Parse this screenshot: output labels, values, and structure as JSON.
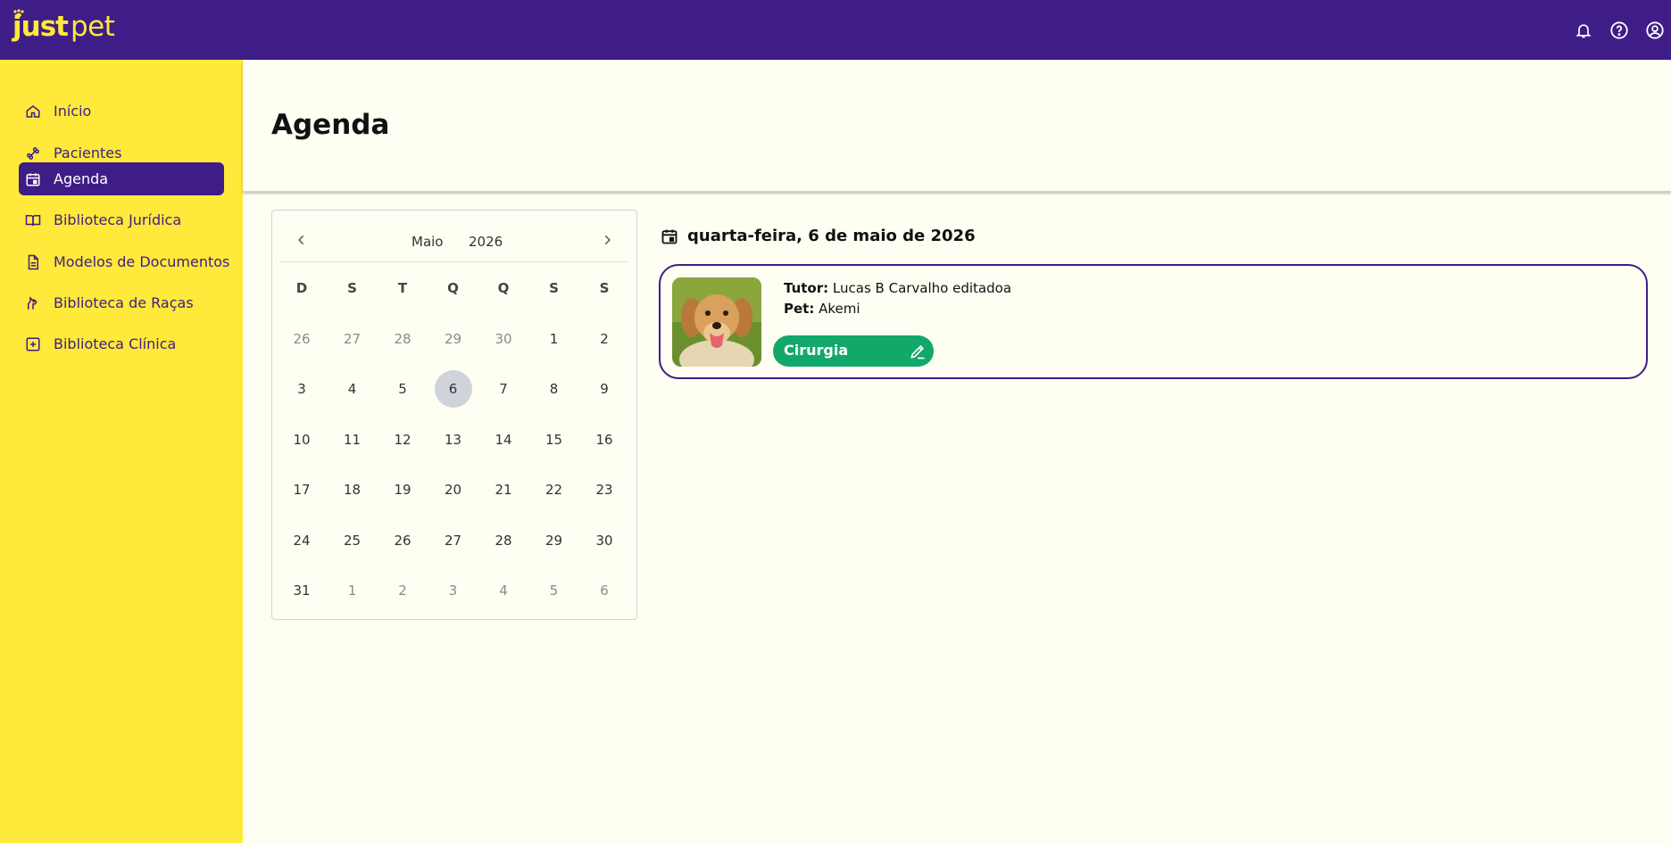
{
  "brand": {
    "part1": "just",
    "part2": "pet",
    "color_bg": "#3f1d87",
    "color_accent": "#ffe93a"
  },
  "topbar_icons": [
    "bell-icon",
    "help-icon",
    "account-icon"
  ],
  "sidebar": {
    "items": [
      {
        "label": "Início",
        "icon": "home-icon",
        "active": false
      },
      {
        "label": "Pacientes",
        "icon": "bone-icon",
        "active": false
      },
      {
        "label": "Agenda",
        "icon": "calendar-icon",
        "active": true
      },
      {
        "label": "Biblioteca Jurídica",
        "icon": "book-icon",
        "active": false
      },
      {
        "label": "Modelos de Documentos",
        "icon": "document-icon",
        "active": false
      },
      {
        "label": "Biblioteca de Raças",
        "icon": "dog-icon",
        "active": false
      },
      {
        "label": "Biblioteca Clínica",
        "icon": "medical-plus-icon",
        "active": false
      }
    ]
  },
  "page": {
    "title": "Agenda"
  },
  "calendar": {
    "month": "Maio",
    "year": "2026",
    "weekdays": [
      "D",
      "S",
      "T",
      "Q",
      "Q",
      "S",
      "S"
    ],
    "weeks": [
      [
        {
          "d": "26",
          "out": true
        },
        {
          "d": "27",
          "out": true
        },
        {
          "d": "28",
          "out": true
        },
        {
          "d": "29",
          "out": true
        },
        {
          "d": "30",
          "out": true
        },
        {
          "d": "1"
        },
        {
          "d": "2"
        }
      ],
      [
        {
          "d": "3"
        },
        {
          "d": "4"
        },
        {
          "d": "5"
        },
        {
          "d": "6",
          "selected": true
        },
        {
          "d": "7"
        },
        {
          "d": "8"
        },
        {
          "d": "9"
        }
      ],
      [
        {
          "d": "10"
        },
        {
          "d": "11"
        },
        {
          "d": "12"
        },
        {
          "d": "13"
        },
        {
          "d": "14"
        },
        {
          "d": "15"
        },
        {
          "d": "16"
        }
      ],
      [
        {
          "d": "17"
        },
        {
          "d": "18"
        },
        {
          "d": "19"
        },
        {
          "d": "20"
        },
        {
          "d": "21"
        },
        {
          "d": "22"
        },
        {
          "d": "23"
        }
      ],
      [
        {
          "d": "24"
        },
        {
          "d": "25"
        },
        {
          "d": "26"
        },
        {
          "d": "27"
        },
        {
          "d": "28"
        },
        {
          "d": "29"
        },
        {
          "d": "30"
        }
      ],
      [
        {
          "d": "31"
        },
        {
          "d": "1",
          "out": true
        },
        {
          "d": "2",
          "out": true
        },
        {
          "d": "3",
          "out": true
        },
        {
          "d": "4",
          "out": true
        },
        {
          "d": "5",
          "out": true
        },
        {
          "d": "6",
          "out": true
        }
      ]
    ]
  },
  "selected_day": {
    "label": "quarta-feira, 6 de maio de 2026"
  },
  "appointment": {
    "tutor_label": "Tutor:",
    "tutor_value": "Lucas B Carvalho editadoa",
    "pet_label": "Pet:",
    "pet_value": "Akemi",
    "tag_label": "Cirurgia",
    "tag_color": "#12a86a"
  }
}
